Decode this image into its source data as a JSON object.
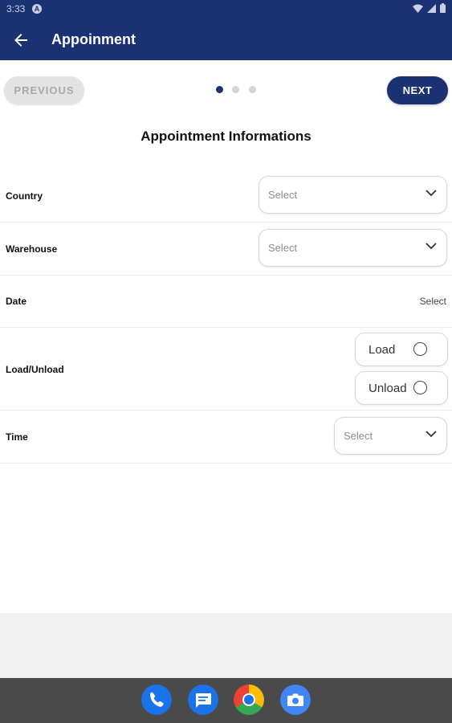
{
  "status_bar": {
    "time": "3:33"
  },
  "app_bar": {
    "title": "Appoinment"
  },
  "pager": {
    "previous_label": "PREVIOUS",
    "next_label": "NEXT",
    "page_count": 3,
    "active_page": 1
  },
  "form": {
    "heading": "Appointment Informations",
    "country": {
      "label": "Country",
      "placeholder": "Select"
    },
    "warehouse": {
      "label": "Warehouse",
      "placeholder": "Select"
    },
    "date": {
      "label": "Date",
      "value": "Select"
    },
    "load_unload": {
      "label": "Load/Unload",
      "options": [
        "Load",
        "Unload"
      ]
    },
    "time": {
      "label": "Time",
      "placeholder": "Select"
    }
  },
  "dock": {
    "apps": [
      "phone-icon",
      "messages-icon",
      "chrome-icon",
      "camera-icon"
    ]
  },
  "colors": {
    "primary": "#1b3272",
    "disabled": "#e3e3e3"
  }
}
